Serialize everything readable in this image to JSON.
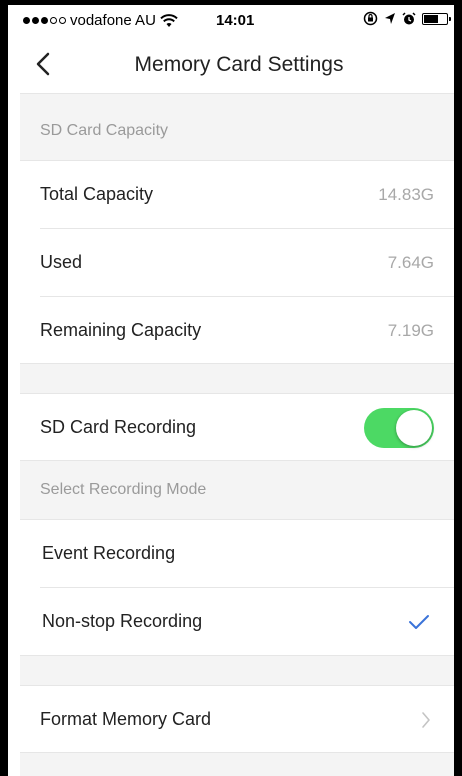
{
  "status_bar": {
    "carrier": "vodafone AU",
    "time": "14:01",
    "signal_bars_filled": 3,
    "signal_bars_total": 5
  },
  "nav": {
    "title": "Memory Card Settings"
  },
  "sd_capacity": {
    "header": "SD Card Capacity",
    "rows": [
      {
        "label": "Total Capacity",
        "value": "14.83G"
      },
      {
        "label": "Used",
        "value": "7.64G"
      },
      {
        "label": "Remaining Capacity",
        "value": "7.19G"
      }
    ]
  },
  "recording": {
    "sd_card_recording_label": "SD Card Recording",
    "sd_card_recording_on": true,
    "mode_header": "Select Recording Mode",
    "modes": [
      {
        "label": "Event Recording",
        "selected": false
      },
      {
        "label": "Non-stop Recording",
        "selected": true
      }
    ]
  },
  "format": {
    "label": "Format Memory Card"
  },
  "colors": {
    "toggle_on": "#4cd964",
    "check": "#3a73d9",
    "section_bg": "#f4f4f4"
  },
  "icons": [
    "back-chevron-icon",
    "wifi-icon",
    "lock-rotation-icon",
    "location-icon",
    "alarm-icon",
    "battery-icon",
    "checkmark-icon",
    "chevron-right-icon"
  ]
}
